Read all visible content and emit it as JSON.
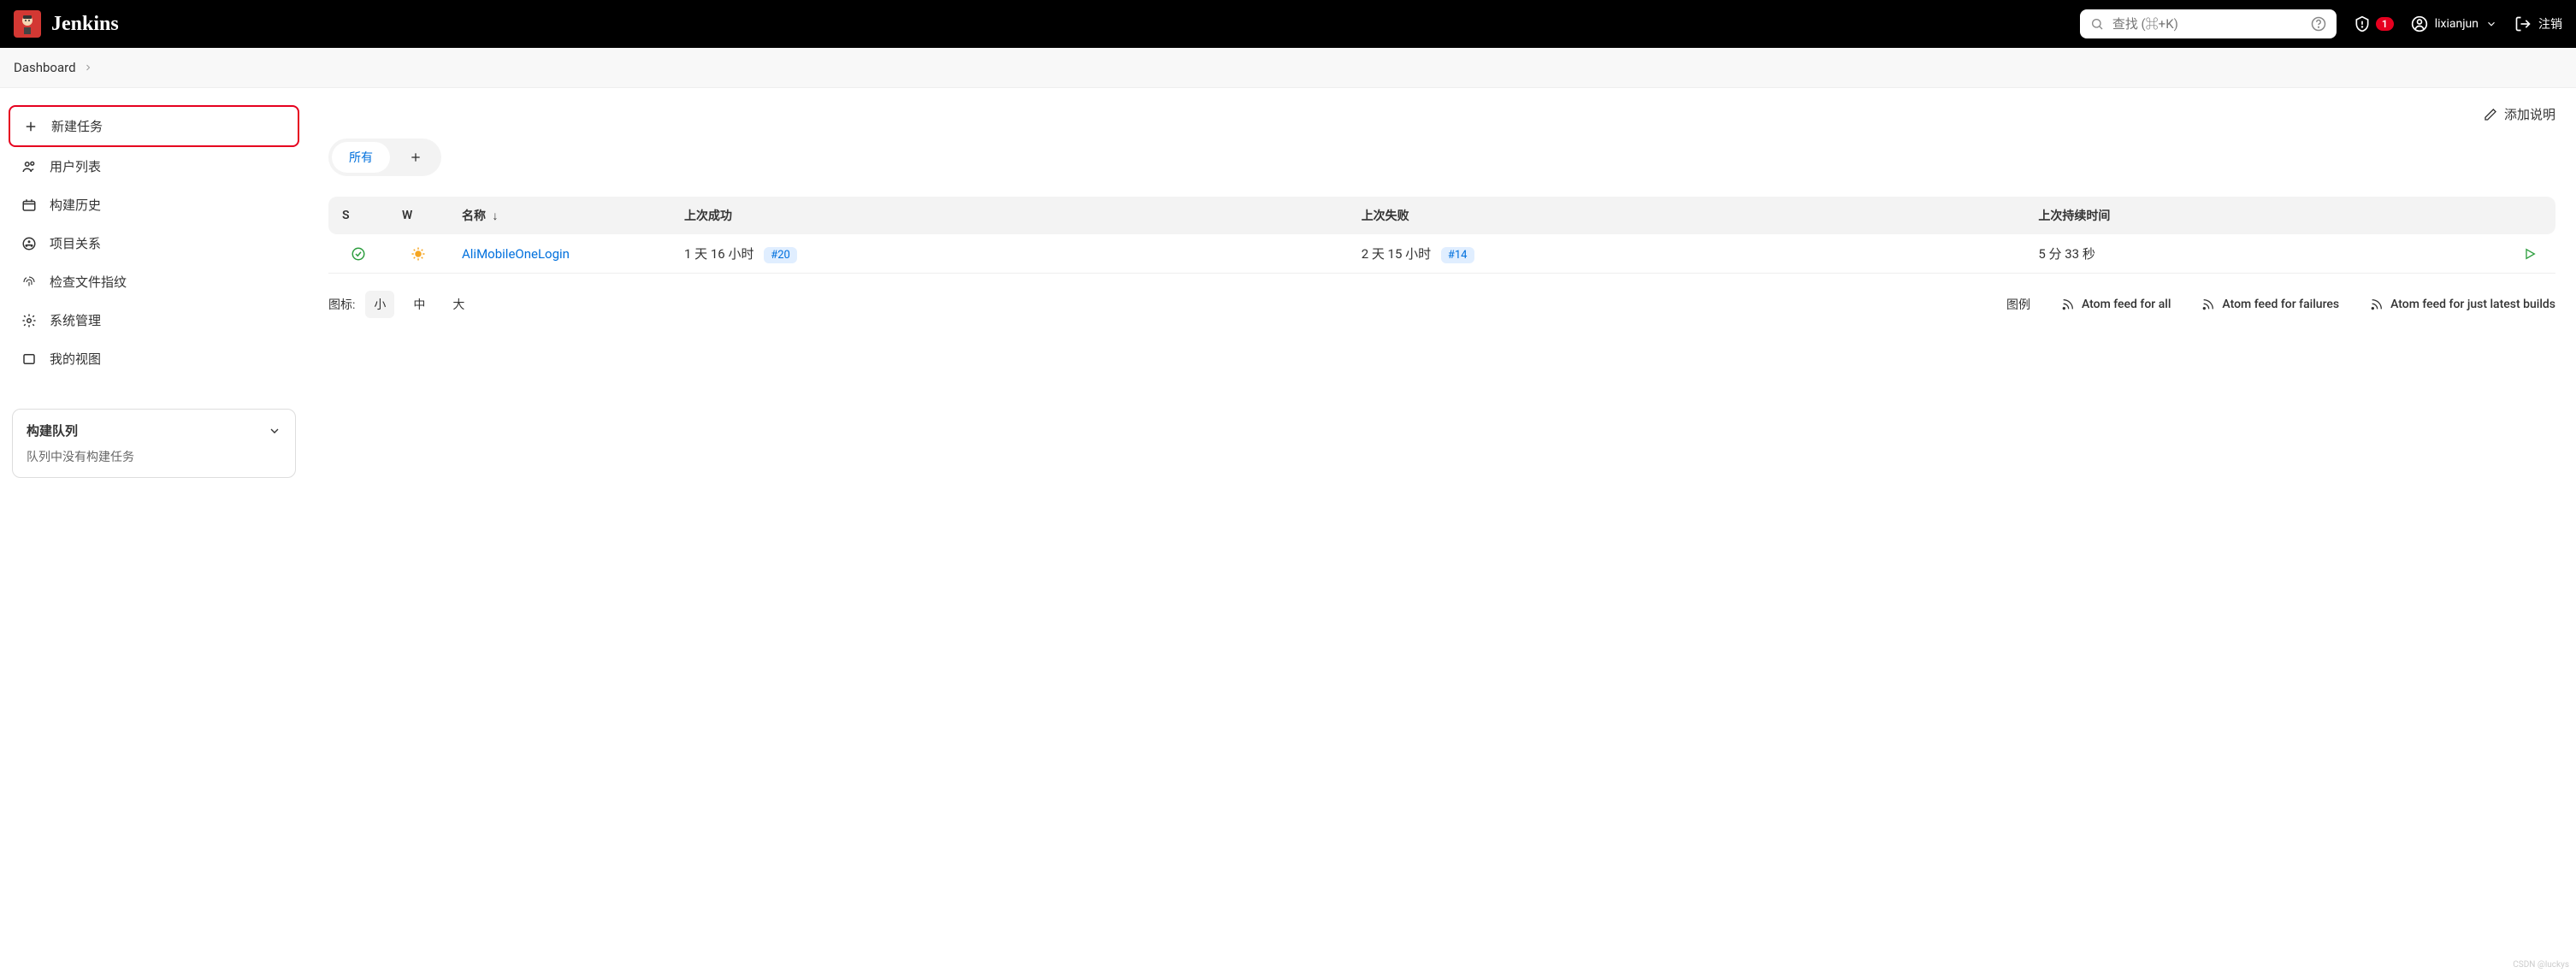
{
  "header": {
    "brand": "Jenkins",
    "search_placeholder": "查找 (⌘+K)",
    "alert_count": "1",
    "username": "lixianjun",
    "logout_label": "注销"
  },
  "breadcrumb": {
    "items": [
      "Dashboard"
    ]
  },
  "sidebar": {
    "items": [
      {
        "label": "新建任务",
        "icon": "plus"
      },
      {
        "label": "用户列表",
        "icon": "people"
      },
      {
        "label": "构建历史",
        "icon": "history"
      },
      {
        "label": "项目关系",
        "icon": "relations"
      },
      {
        "label": "检查文件指纹",
        "icon": "fingerprint"
      },
      {
        "label": "系统管理",
        "icon": "gear"
      },
      {
        "label": "我的视图",
        "icon": "view"
      }
    ],
    "queue": {
      "title": "构建队列",
      "empty_text": "队列中没有构建任务"
    }
  },
  "content": {
    "add_desc_label": "添加说明",
    "tabs": {
      "active": "所有"
    },
    "table": {
      "headers": {
        "s": "S",
        "w": "W",
        "name": "名称",
        "last_success": "上次成功",
        "last_failure": "上次失败",
        "last_duration": "上次持续时间"
      },
      "rows": [
        {
          "name": "AliMobileOneLogin",
          "last_success_time": "1 天 16 小时",
          "last_success_build": "#20",
          "last_failure_time": "2 天 15 小时",
          "last_failure_build": "#14",
          "duration": "5 分 33 秒"
        }
      ]
    },
    "footer": {
      "icon_label": "图标:",
      "sizes": [
        "小",
        "中",
        "大"
      ],
      "legend_label": "图例",
      "atom_all": "Atom feed for all",
      "atom_failures": "Atom feed for failures",
      "atom_latest": "Atom feed for just latest builds"
    }
  },
  "watermark": "CSDN @luckys"
}
